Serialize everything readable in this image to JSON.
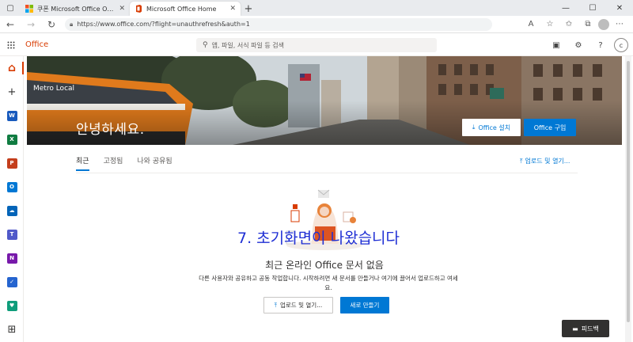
{
  "browser": {
    "tabs": [
      {
        "title": "쿠폰 Microsoft Office Online | W",
        "active": false
      },
      {
        "title": "Microsoft Office Home",
        "active": true
      }
    ],
    "new_tab_symbol": "+",
    "address": "https://www.office.com/?flight=unauthrefresh&auth=1",
    "window_controls": [
      "—",
      "☐",
      "✕"
    ]
  },
  "office_header": {
    "brand": "Office",
    "search_placeholder": "앱, 파일, 서식 파일 등 검색",
    "avatar_initial": "c"
  },
  "rail": [
    {
      "name": "home",
      "color": "#d83b01",
      "glyph": "⌂"
    },
    {
      "name": "create",
      "color": "#323130",
      "glyph": "+"
    },
    {
      "name": "word",
      "color": "#185abd",
      "glyph": "W"
    },
    {
      "name": "excel",
      "color": "#107c41",
      "glyph": "X"
    },
    {
      "name": "powerpoint",
      "color": "#c43e1c",
      "glyph": "P"
    },
    {
      "name": "outlook",
      "color": "#0078d4",
      "glyph": "O"
    },
    {
      "name": "onedrive",
      "color": "#0364b8",
      "glyph": "☁"
    },
    {
      "name": "teams",
      "color": "#5059c9",
      "glyph": "T"
    },
    {
      "name": "onenote",
      "color": "#7719aa",
      "glyph": "N"
    },
    {
      "name": "todo",
      "color": "#2564cf",
      "glyph": "✓"
    },
    {
      "name": "family-safety",
      "color": "#0f9d7b",
      "glyph": "♥"
    },
    {
      "name": "all-apps",
      "color": "#323130",
      "glyph": "⊞"
    }
  ],
  "hero": {
    "greeting": "안녕하세요.",
    "install_label": "Office 설치",
    "buy_label": "Office 구입"
  },
  "content": {
    "tabs": [
      "최근",
      "고정됨",
      "나와 공유됨"
    ],
    "upload_open_link": "업로드 및 열기...",
    "annotation": "7. 초기화면이 나왔습니다",
    "empty_title": "최근 온라인 Office 문서 없음",
    "empty_desc": "다른 사용자와 공유하고 공동 작업합니다. 시작하려면 새 문서를 만들거나 여기에 끌어서 업로드하고 여세요.",
    "upload_button": "업로드 및 열기...",
    "new_button": "새로 만들기"
  },
  "feedback": {
    "label": "피드백"
  }
}
